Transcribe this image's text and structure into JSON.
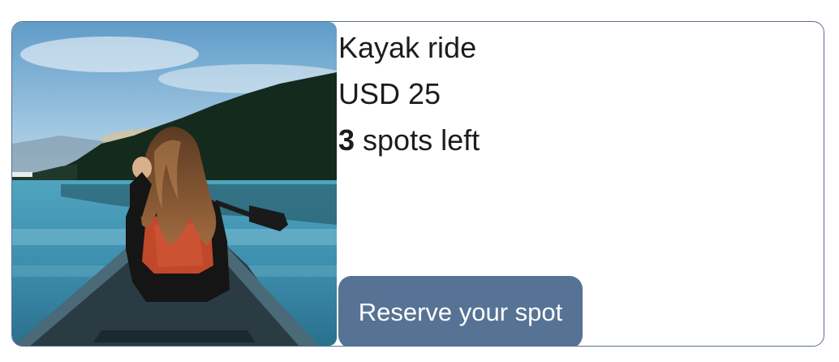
{
  "listing": {
    "image_alt": "Person paddling a canoe on a mountain lake",
    "title": "Kayak ride",
    "price": "USD 25",
    "spots_count": "3",
    "spots_suffix": " spots left",
    "reserve_label": "Reserve your spot"
  },
  "colors": {
    "border": "#5a7191",
    "button": "#567395",
    "text": "#1c1c1c"
  }
}
